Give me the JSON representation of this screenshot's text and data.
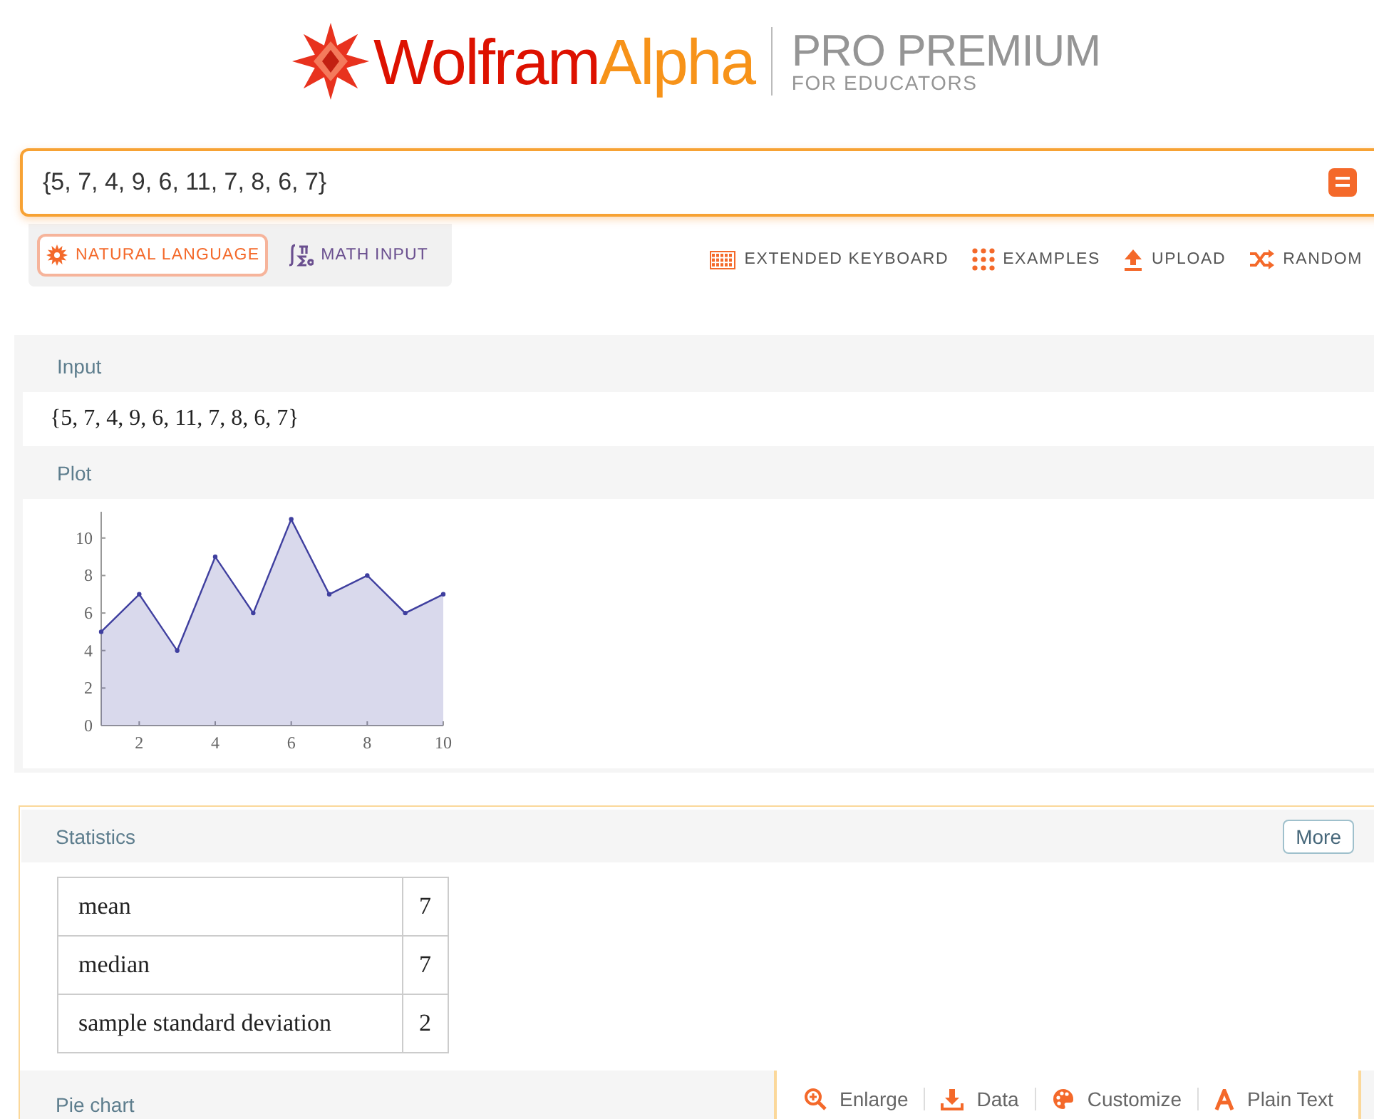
{
  "logo": {
    "brand_first": "Wolfram",
    "brand_second": "Alpha",
    "tier": "PRO PREMIUM",
    "audience": "FOR EDUCATORS"
  },
  "search": {
    "value": "{5, 7, 4, 9, 6, 11, 7, 8, 6, 7}"
  },
  "input_modes": [
    {
      "label": "NATURAL LANGUAGE",
      "kind": "natural",
      "selected": true
    },
    {
      "label": "MATH INPUT",
      "kind": "math",
      "selected": false
    }
  ],
  "tools": [
    {
      "label": "EXTENDED KEYBOARD",
      "kind": "keyboard"
    },
    {
      "label": "EXAMPLES",
      "kind": "examples"
    },
    {
      "label": "UPLOAD",
      "kind": "upload"
    },
    {
      "label": "RANDOM",
      "kind": "random"
    }
  ],
  "pods": [
    {
      "title": "Input",
      "kind": "text",
      "text": "{5, 7, 4, 9, 6, 11, 7, 8, 6, 7}"
    },
    {
      "title": "Plot",
      "kind": "chart",
      "chart_data": {
        "type": "area",
        "x": [
          1,
          2,
          3,
          4,
          5,
          6,
          7,
          8,
          9,
          10
        ],
        "series": [
          {
            "color": "#3f3f9f",
            "values": [
              5,
              7,
              4,
              9,
              6,
              11,
              7,
              8,
              6,
              7
            ]
          }
        ],
        "xlim": [
          1,
          10
        ],
        "ylim": [
          0,
          11.4
        ],
        "xticks": [
          2,
          4,
          6,
          8,
          10
        ],
        "yticks": [
          0,
          2,
          4,
          6,
          8,
          10
        ]
      }
    }
  ],
  "statistics": {
    "title": "Statistics",
    "more": "More",
    "rows": [
      {
        "label": "mean",
        "value": "7"
      },
      {
        "label": "median",
        "value": "7"
      },
      {
        "label": "sample standard deviation",
        "value": "2"
      }
    ]
  },
  "next_pod": {
    "title": "Pie chart",
    "actions": [
      {
        "label": "Enlarge",
        "kind": "enlarge"
      },
      {
        "label": "Data",
        "kind": "data"
      },
      {
        "label": "Customize",
        "kind": "customize"
      },
      {
        "label": "Plain Text",
        "kind": "plaintext"
      }
    ]
  }
}
